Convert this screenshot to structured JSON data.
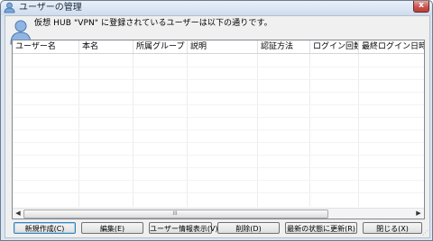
{
  "window": {
    "title": "ユーザーの管理",
    "close_label": "x"
  },
  "description": "仮想 HUB \"VPN\" に登録されているユーザーは以下の通りです。",
  "list": {
    "columns": [
      "ユーザー名",
      "本名",
      "所属グループ",
      "説明",
      "認証方法",
      "ログイン回数",
      "最終ログイン日時"
    ],
    "scroll_grip": "III",
    "scroll_left": "◀",
    "scroll_right": "▶"
  },
  "buttons": {
    "new": "新規作成(C)",
    "edit": "編集(E)",
    "info": "ユーザー情報表示(V)",
    "delete": "削除(D)",
    "refresh": "最新の状態に更新(R)",
    "close": "閉じる(X)"
  },
  "colors": {
    "accent": "#3c7fb1",
    "title_bg": "#dbe6f3"
  }
}
